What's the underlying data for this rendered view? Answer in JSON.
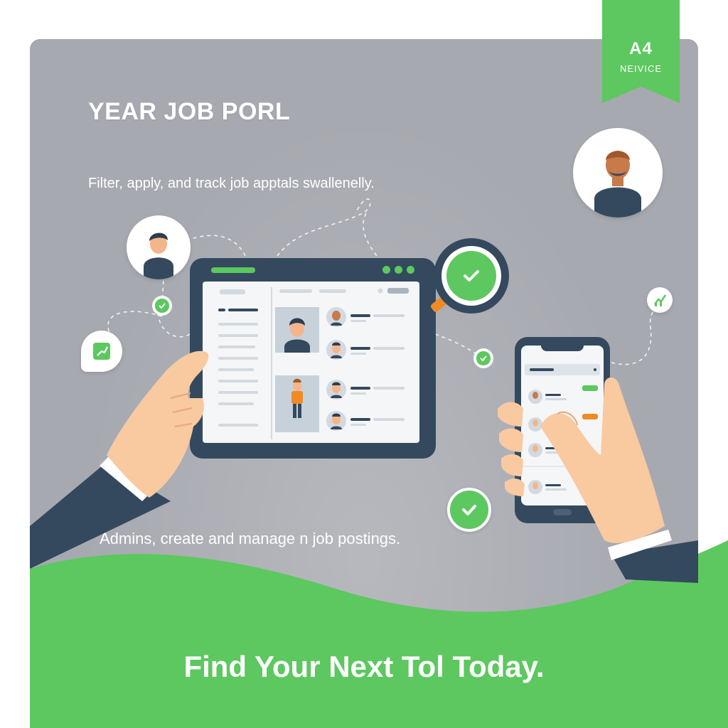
{
  "badge": {
    "code": "A4",
    "label": "NEIVICE"
  },
  "hero": {
    "title": "YEAR JOB PORL",
    "subtitle": "Filter, apply, and track job apptals swallenelly.",
    "admin_note": "Admins, create and manage n job postings.",
    "cta": "Find Your Next Tol Today."
  },
  "colors": {
    "accent": "#5cc85f",
    "panel": "#a7a9b0",
    "device": "#34495e",
    "highlight": "#f08a24",
    "skin": "#f9c9a0"
  },
  "icons": [
    "user-avatar-icon",
    "check-icon",
    "magnifier-icon",
    "chart-chat-icon",
    "tablet-device",
    "phone-device"
  ]
}
